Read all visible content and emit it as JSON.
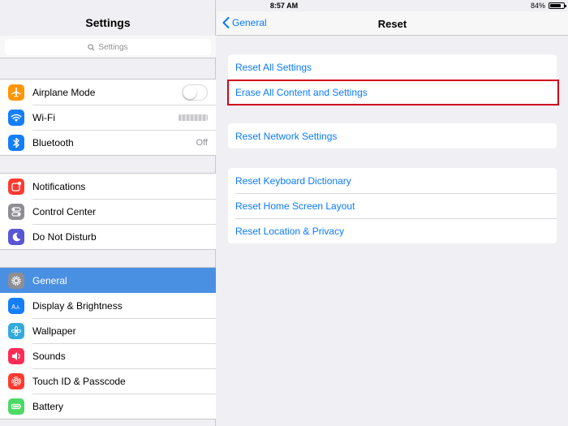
{
  "status_bar": {
    "device": "iPad",
    "time": "8:57 AM",
    "battery_percent": "84%",
    "battery_level": 0.84
  },
  "sidebar": {
    "title": "Settings",
    "search_placeholder": "Settings",
    "groups": [
      [
        {
          "label": "Airplane Mode",
          "icon": "airplane-icon",
          "color": "#ff9500",
          "accessory": "toggle-off"
        },
        {
          "label": "Wi-Fi",
          "icon": "wifi-icon",
          "color": "#147efb",
          "accessory": "obscured-network-name"
        },
        {
          "label": "Bluetooth",
          "icon": "bluetooth-icon",
          "color": "#147efb",
          "value": "Off"
        }
      ],
      [
        {
          "label": "Notifications",
          "icon": "notifications-icon",
          "color": "#ff3b30"
        },
        {
          "label": "Control Center",
          "icon": "control-center-icon",
          "color": "#8e8e93"
        },
        {
          "label": "Do Not Disturb",
          "icon": "moon-icon",
          "color": "#5856d6"
        }
      ],
      [
        {
          "label": "General",
          "icon": "gear-icon",
          "color": "#8e8e93",
          "selected": true
        },
        {
          "label": "Display & Brightness",
          "icon": "display-brightness-icon",
          "color": "#147efb"
        },
        {
          "label": "Wallpaper",
          "icon": "wallpaper-icon",
          "color": "#34aadc"
        },
        {
          "label": "Sounds",
          "icon": "speaker-icon",
          "color": "#ff2d55"
        },
        {
          "label": "Touch ID & Passcode",
          "icon": "fingerprint-icon",
          "color": "#ff3b30"
        },
        {
          "label": "Battery",
          "icon": "battery-icon",
          "color": "#4cd964"
        }
      ]
    ]
  },
  "detail": {
    "back_label": "General",
    "title": "Reset",
    "groups": [
      [
        "Reset All Settings",
        "Erase All Content and Settings"
      ],
      [
        "Reset Network Settings"
      ],
      [
        "Reset Keyboard Dictionary",
        "Reset Home Screen Layout",
        "Reset Location & Privacy"
      ]
    ],
    "highlight_color": "#d0021b",
    "accent_color": "#0a7aff"
  }
}
